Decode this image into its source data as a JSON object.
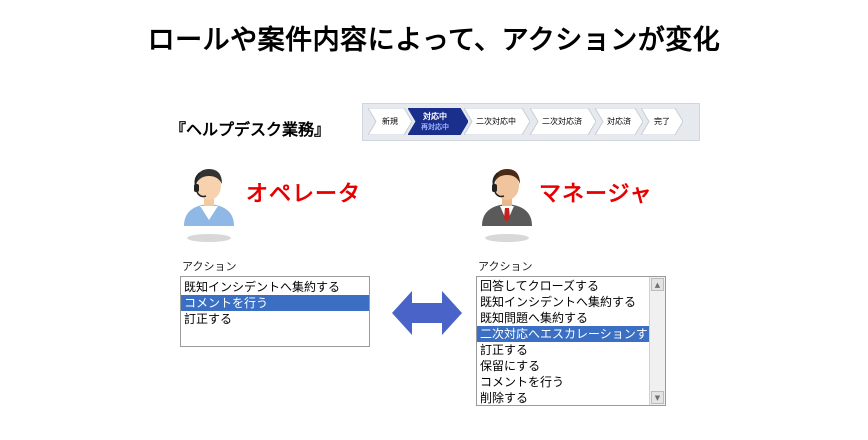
{
  "title": "ロールや案件内容によって、アクションが変化",
  "section_label": "『ヘルプデスク業務』",
  "workflow": {
    "steps": [
      {
        "label": "新規",
        "sub": "",
        "active": false
      },
      {
        "label": "対応中",
        "sub": "再対応中",
        "active": true
      },
      {
        "label": "二次対応中",
        "sub": "",
        "active": false
      },
      {
        "label": "二次対応済",
        "sub": "",
        "active": false
      },
      {
        "label": "対応済",
        "sub": "",
        "active": false
      },
      {
        "label": "完了",
        "sub": "",
        "active": false
      }
    ],
    "colors": {
      "active": "#1a2f8c",
      "inactive": "#ffffff"
    }
  },
  "operator": {
    "role": "オペレータ",
    "action_label": "アクション",
    "options": [
      "既知インシデントへ集約する",
      "コメントを行う",
      "訂正する"
    ],
    "selected_index": 1
  },
  "manager": {
    "role": "マネージャ",
    "action_label": "アクション",
    "options": [
      "回答してクローズする",
      "既知インシデントへ集約する",
      "既知問題へ集約する",
      "二次対応へエスカレーションする",
      "訂正する",
      "保留にする",
      "コメントを行う",
      "削除する"
    ],
    "selected_index": 3
  },
  "colors": {
    "role_text": "#e60000",
    "selection": "#3a6fc4",
    "arrow": "#4a63c8"
  },
  "icons": [
    "operator-avatar-icon",
    "manager-avatar-icon",
    "double-arrow-icon",
    "scroll-up-icon",
    "scroll-down-icon"
  ]
}
